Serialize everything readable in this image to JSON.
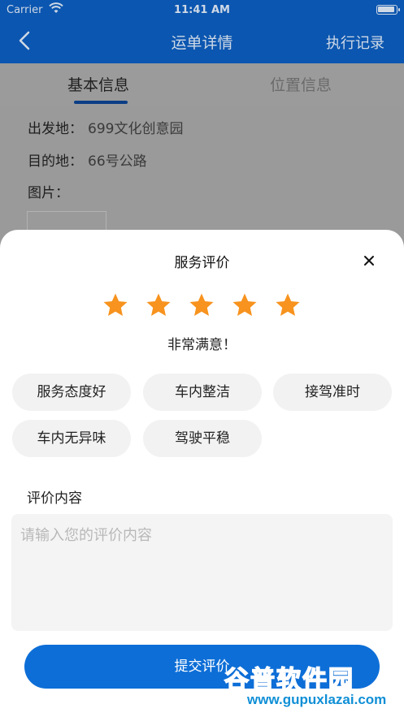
{
  "status_bar": {
    "carrier": "Carrier",
    "time": "11:41 AM"
  },
  "nav": {
    "title": "运单详情",
    "right_action": "执行记录"
  },
  "tabs": [
    {
      "label": "基本信息",
      "active": true
    },
    {
      "label": "位置信息",
      "active": false
    }
  ],
  "details": {
    "origin": {
      "key": "出发地：",
      "value": "699文化创意园"
    },
    "destination": {
      "key": "目的地：",
      "value": "66号公路"
    },
    "images": {
      "key": "图片："
    }
  },
  "sheet": {
    "title": "服务评价",
    "stars": {
      "rating": 5,
      "max": 5,
      "color": "#f7931e"
    },
    "rating_text": "非常满意！",
    "tags": [
      "服务态度好",
      "车内整洁",
      "接驾准时",
      "车内无异味",
      "驾驶平稳"
    ],
    "comment_label": "评价内容",
    "comment_placeholder": "请输入您的评价内容",
    "submit_label": "提交评价"
  },
  "watermark": {
    "text": "谷普软件园",
    "url": "www.gupuxlazai.com"
  },
  "colors": {
    "nav_bg": "#0b56b0",
    "primary": "#0d6ed7",
    "chip_bg": "#f2f2f2",
    "star": "#f7931e"
  }
}
